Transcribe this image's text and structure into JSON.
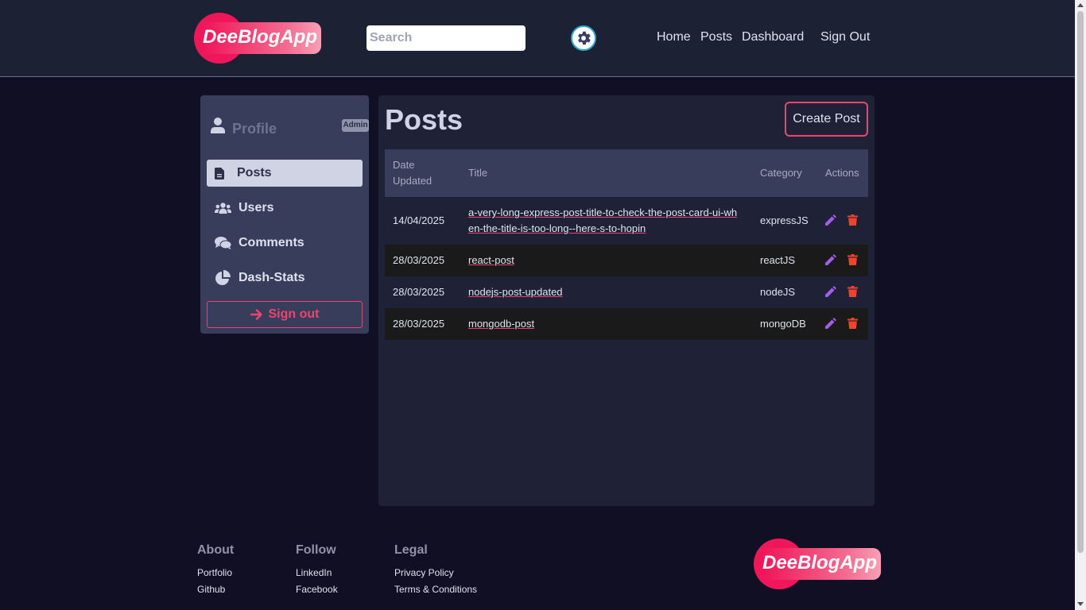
{
  "brand": {
    "name": "DeeBlogApp"
  },
  "header": {
    "search_placeholder": "Search",
    "nav": [
      "Home",
      "Posts",
      "Dashboard",
      "Sign Out"
    ]
  },
  "sidebar": {
    "profile_label": "Profile",
    "role_badge": "Admin",
    "items": [
      {
        "label": "Posts",
        "icon": "document-icon",
        "active": true
      },
      {
        "label": "Users",
        "icon": "users-icon",
        "active": false
      },
      {
        "label": "Comments",
        "icon": "comments-icon",
        "active": false
      },
      {
        "label": "Dash-Stats",
        "icon": "pie-chart-icon",
        "active": false
      }
    ],
    "signout_label": "Sign out"
  },
  "main": {
    "title": "Posts",
    "create_button": "Create Post",
    "table": {
      "headers": [
        "Date Updated",
        "Title",
        "Category",
        "Actions"
      ],
      "rows": [
        {
          "date": "14/04/2025",
          "title": "a-very-long-express-post-title-to-check-the-post-card-ui-when-the-title-is-too-long--here-s-to-hopin",
          "category": "expressJS"
        },
        {
          "date": "28/03/2025",
          "title": "react-post",
          "category": "reactJS"
        },
        {
          "date": "28/03/2025",
          "title": "nodejs-post-updated",
          "category": "nodeJS"
        },
        {
          "date": "28/03/2025",
          "title": "mongodb-post",
          "category": "mongoDB"
        }
      ]
    }
  },
  "footer": {
    "columns": [
      {
        "heading": "About",
        "links": [
          "Portfolio",
          "Github"
        ]
      },
      {
        "heading": "Follow",
        "links": [
          "LinkedIn",
          "Facebook"
        ]
      },
      {
        "heading": "Legal",
        "links": [
          "Privacy Policy",
          "Terms & Conditions"
        ]
      }
    ]
  },
  "colors": {
    "accent": "#f0436f",
    "brand_pink": "#f0165a",
    "edit_icon": "#a35cf0",
    "delete_icon": "#f0432f",
    "page_bg": "#110f24",
    "header_bg": "#1d2134",
    "sidebar_bg": "#383d5c"
  }
}
